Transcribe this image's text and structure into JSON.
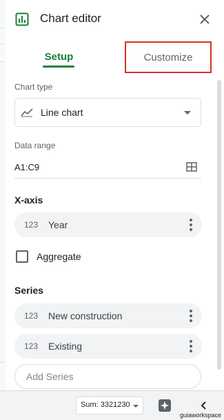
{
  "header": {
    "title": "Chart editor"
  },
  "tabs": [
    {
      "label": "Setup"
    },
    {
      "label": "Customize"
    }
  ],
  "setup": {
    "chart_type": {
      "label": "Chart type",
      "value": "Line chart"
    },
    "data_range": {
      "label": "Data range",
      "value": "A1:C9"
    },
    "x_axis": {
      "title": "X-axis",
      "chip": {
        "type_icon": "123",
        "label": "Year"
      }
    },
    "aggregate": {
      "label": "Aggregate",
      "checked": false
    },
    "series": {
      "title": "Series",
      "items": [
        {
          "type_icon": "123",
          "label": "New construction"
        },
        {
          "type_icon": "123",
          "label": "Existing"
        }
      ],
      "add_label": "Add Series"
    }
  },
  "bottom_bar": {
    "sum": "Sum: 3321230",
    "watermark": "guiaworkspace"
  },
  "colors": {
    "accent": "#188038",
    "highlight_box": "#d93025"
  },
  "icons": [
    "chart-icon",
    "close-icon",
    "line-chart-icon",
    "grid-icon",
    "more-vert-icon",
    "explore-icon",
    "chevron-left-icon"
  ]
}
